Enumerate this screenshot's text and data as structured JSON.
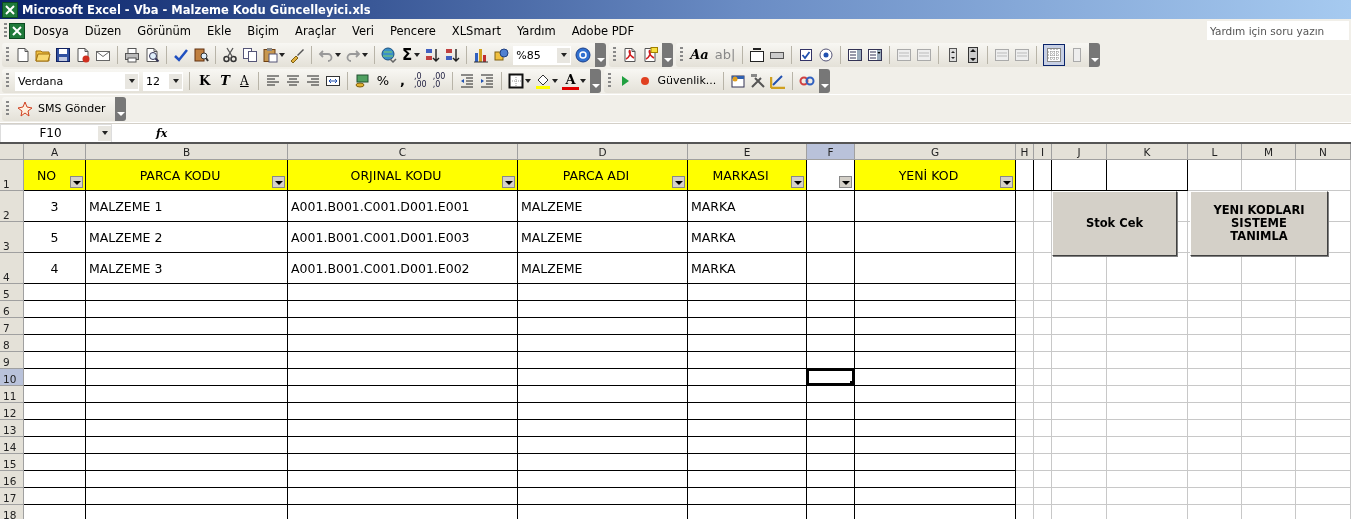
{
  "window": {
    "title": "Microsoft Excel - Vba - Malzeme Kodu Güncelleyici.xls"
  },
  "menu": [
    "Dosya",
    "Düzen",
    "Görünüm",
    "Ekle",
    "Biçim",
    "Araçlar",
    "Veri",
    "Pencere",
    "XLSmart",
    "Yardım",
    "Adobe PDF"
  ],
  "help_box": {
    "placeholder": "Yardım için soru yazın"
  },
  "standard_toolbar": {
    "sum": "Σ",
    "zoom": "%85"
  },
  "forms_toolbar": {
    "label_tool": "Aa",
    "edit_box_tool": "ab|",
    "grid_pressed": true
  },
  "formatting_toolbar": {
    "font": "Verdana",
    "size": "12",
    "bold": "K",
    "italic": "T",
    "underline": "A",
    "percent": "%",
    "comma": ",",
    "increase_decimal": [
      ",0",
      ",00"
    ],
    "decrease_decimal": [
      ",00",
      ",0"
    ],
    "font_color": "A"
  },
  "visual_basic_toolbar": {
    "security": "Güvenlik..."
  },
  "sms_toolbar": {
    "label": "SMS Gönder"
  },
  "formula_bar": {
    "name_box": "F10",
    "function_label": "fx"
  },
  "sheet": {
    "columns": [
      {
        "label": "A",
        "selected": false
      },
      {
        "label": "B",
        "selected": false
      },
      {
        "label": "C",
        "selected": false
      },
      {
        "label": "D",
        "selected": false
      },
      {
        "label": "E",
        "selected": false
      },
      {
        "label": "F",
        "selected": true
      },
      {
        "label": "G",
        "selected": false
      },
      {
        "label": "H",
        "selected": false
      },
      {
        "label": "I",
        "selected": false
      },
      {
        "label": "J",
        "selected": false
      },
      {
        "label": "K",
        "selected": false
      },
      {
        "label": "L",
        "selected": false
      },
      {
        "label": "M",
        "selected": false
      },
      {
        "label": "N",
        "selected": false
      }
    ],
    "rows": [
      {
        "label": "1",
        "selected": false,
        "cells": [
          {
            "text": "NO",
            "filter": true,
            "highlighted": true
          },
          {
            "text": "PARCA KODU",
            "filter": true,
            "highlighted": true
          },
          {
            "text": "ORJINAL KODU",
            "filter": true,
            "highlighted": true
          },
          {
            "text": "PARCA ADI",
            "filter": true,
            "highlighted": true
          },
          {
            "text": "MARKASI",
            "filter": true,
            "highlighted": true
          },
          {
            "filter": true,
            "highlighted": false
          },
          {
            "text": "YENİ KOD",
            "filter": true,
            "highlighted": true
          }
        ]
      },
      {
        "label": "2",
        "selected": false,
        "cells": [
          "3",
          "MALZEME 1",
          "A001.B001.C001.D001.E001",
          "MALZEME",
          "MARKA"
        ]
      },
      {
        "label": "3",
        "selected": false,
        "cells": [
          "5",
          "MALZEME 2",
          "A001.B001.C001.D001.E003",
          "MALZEME",
          "MARKA"
        ]
      },
      {
        "label": "4",
        "selected": false,
        "cells": [
          "4",
          "MALZEME 3",
          "A001.B001.C001.D001.E002",
          "MALZEME",
          "MARKA"
        ]
      },
      {
        "label": "5",
        "selected": false
      },
      {
        "label": "6",
        "selected": false
      },
      {
        "label": "7",
        "selected": false
      },
      {
        "label": "8",
        "selected": false
      },
      {
        "label": "9",
        "selected": false
      },
      {
        "label": "10",
        "selected": true
      },
      {
        "label": "11",
        "selected": false
      },
      {
        "label": "12",
        "selected": false
      },
      {
        "label": "13",
        "selected": false
      },
      {
        "label": "14",
        "selected": false
      },
      {
        "label": "15",
        "selected": false
      },
      {
        "label": "16",
        "selected": false
      },
      {
        "label": "17",
        "selected": false
      },
      {
        "label": "18",
        "selected": false
      }
    ]
  },
  "buttons": [
    {
      "label": "Stok Cek"
    },
    {
      "label": "YENI KODLARI SISTEME TANIMLA"
    }
  ]
}
